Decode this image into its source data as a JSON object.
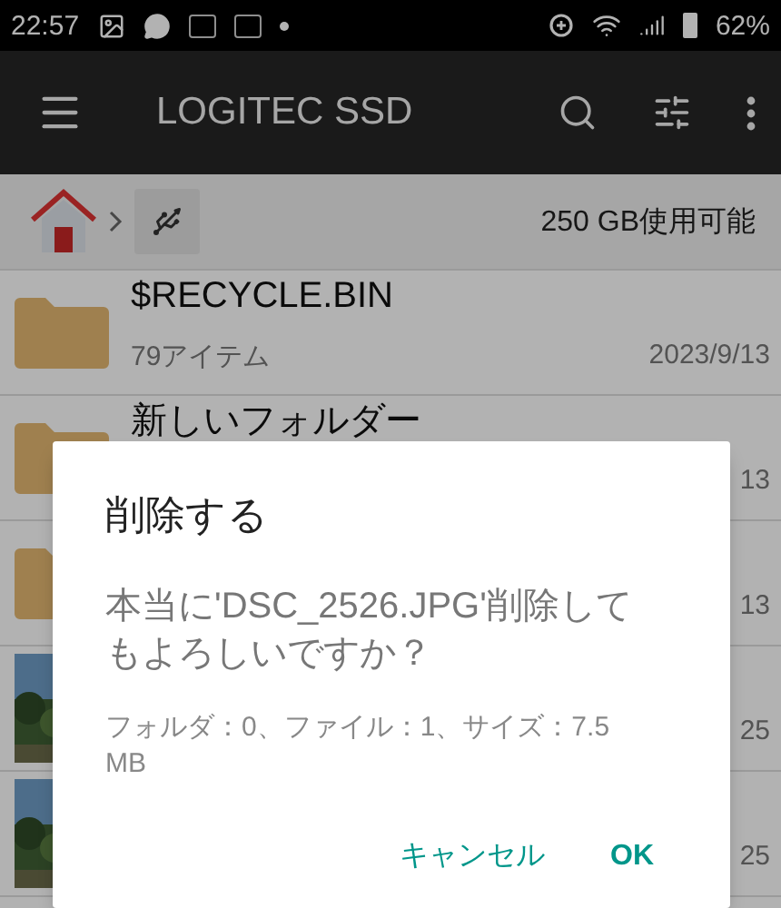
{
  "status_bar": {
    "time": "22:57",
    "battery": "62%"
  },
  "app_bar": {
    "title": "LOGITEC SSD"
  },
  "breadcrumb": {
    "free_space": "250 GB使用可能"
  },
  "files": [
    {
      "kind": "folder",
      "name": "$RECYCLE.BIN",
      "info": "79アイテム",
      "date": "2023/9/13"
    },
    {
      "kind": "folder",
      "name": "新しいフォルダー",
      "date": "13"
    },
    {
      "kind": "folder",
      "date": "13"
    },
    {
      "date": "25"
    },
    {
      "date": "25"
    }
  ],
  "dialog": {
    "title": "削除する",
    "message": "本当に'DSC_2526.JPG'削除してもよろしいですか？",
    "details": "フォルダ：0、ファイル：1、サイズ：7.5 MB",
    "buttons": [
      "キャンセル",
      "OK"
    ]
  }
}
